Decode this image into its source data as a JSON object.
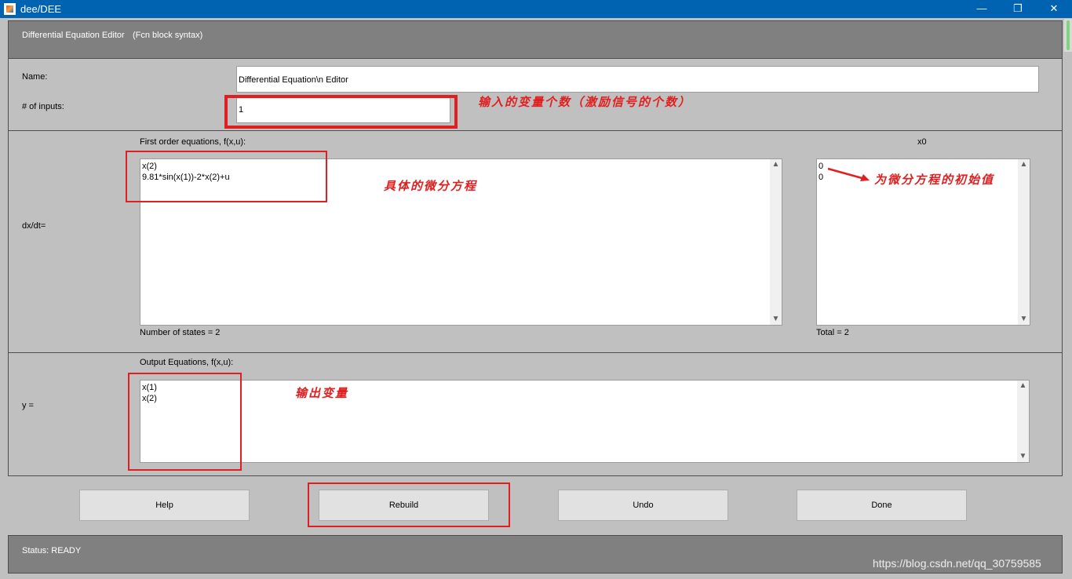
{
  "window": {
    "title": "dee/DEE"
  },
  "header": {
    "title": "Differential Equation Editor",
    "subtitle": "(Fcn block syntax)"
  },
  "form": {
    "name_label": "Name:",
    "name_value": "Differential Equation\\n Editor",
    "inputs_label": "# of inputs:",
    "inputs_value": "1"
  },
  "state_section": {
    "row_label": "dx/dt=",
    "equations_label": "First order equations, f(x,u):",
    "equations": [
      "x(2)",
      "9.81*sin(x(1))-2*x(2)+u"
    ],
    "states_count": "Number of states = 2",
    "x0_label": "x0",
    "x0_values": [
      "0",
      "0"
    ],
    "x0_total": "Total = 2"
  },
  "output_section": {
    "row_label": "y =",
    "equations_label": "Output Equations, f(x,u):",
    "equations": [
      "x(1)",
      "x(2)"
    ]
  },
  "buttons": {
    "help": "Help",
    "rebuild": "Rebuild",
    "undo": "Undo",
    "done": "Done"
  },
  "status": {
    "text": "Status:  READY"
  },
  "annotations": {
    "inputs_note": "输入的变量个数（激励信号的个数）",
    "equations_note": "具体的微分方程",
    "x0_note": "为微分方程的初始值",
    "output_note": "输出变量"
  },
  "watermark": "https://blog.csdn.net/qq_30759585",
  "colors": {
    "titlebar": "#0063b1",
    "annotation_red": "#e02020",
    "dark_panel": "#808080",
    "background": "#c0c0c0"
  }
}
